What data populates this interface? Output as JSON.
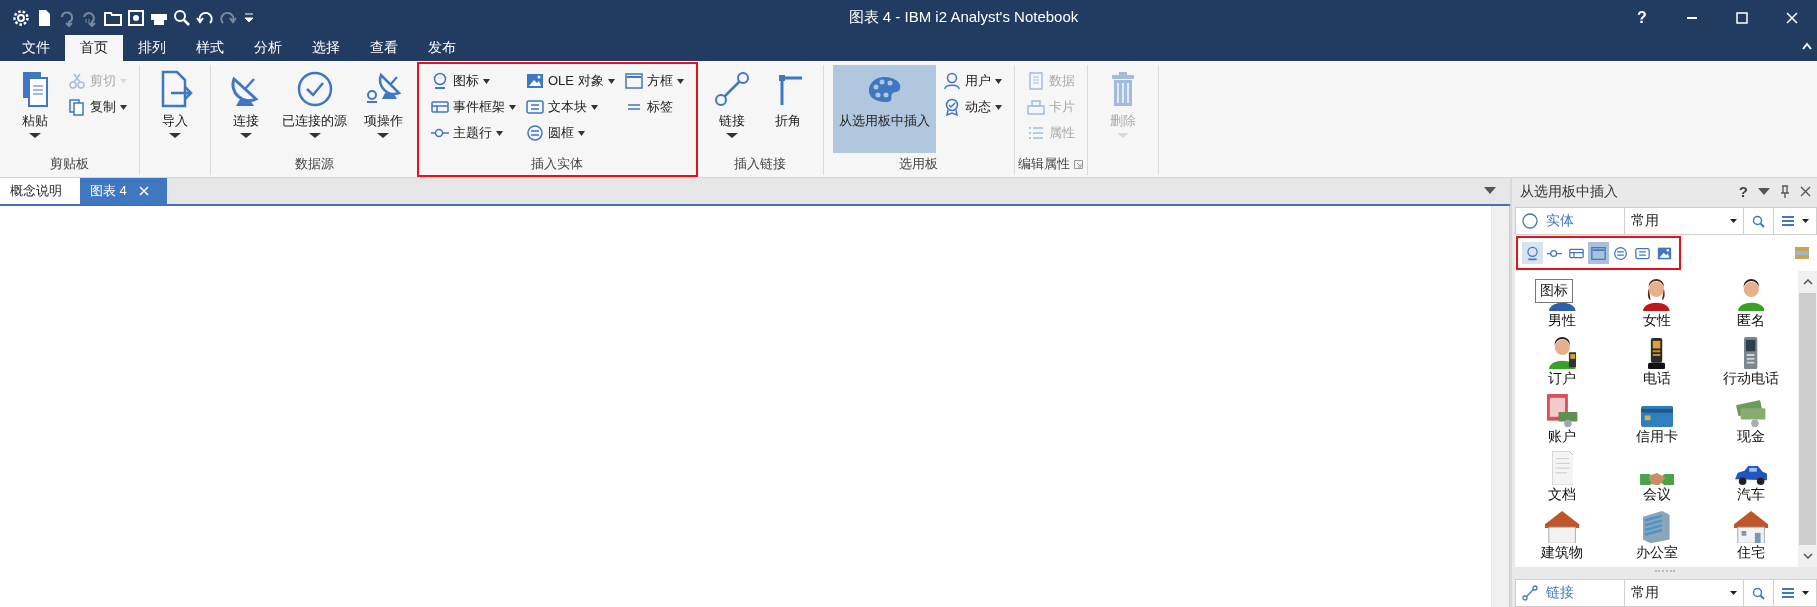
{
  "window": {
    "title": "图表 4 - IBM i2 Analyst's Notebook",
    "help": "?"
  },
  "quick_access_toolbar": [
    {
      "disabled": false
    },
    {
      "disabled": false
    },
    {
      "disabled": true
    },
    {
      "disabled": true
    },
    {
      "disabled": false
    },
    {
      "disabled": false
    },
    {
      "disabled": false
    },
    {
      "disabled": false
    },
    {
      "disabled": false
    },
    {
      "disabled": true
    },
    {
      "disabled": false
    }
  ],
  "menu_tabs": [
    {
      "label": "文件",
      "selected": false
    },
    {
      "label": "首页",
      "selected": true
    },
    {
      "label": "排列",
      "selected": false
    },
    {
      "label": "样式",
      "selected": false
    },
    {
      "label": "分析",
      "selected": false
    },
    {
      "label": "选择",
      "selected": false
    },
    {
      "label": "查看",
      "selected": false
    },
    {
      "label": "发布",
      "selected": false
    }
  ],
  "ribbon": {
    "groups": [
      {
        "label": "剪贴板",
        "columns": [
          {
            "kind": "large",
            "label": "粘贴",
            "dropdown": true
          },
          {
            "kind": "stack",
            "items": [
              {
                "label": "剪切",
                "dropdown": true,
                "disabled": true
              },
              {
                "label": "复制",
                "dropdown": true
              }
            ]
          }
        ]
      },
      {
        "columns": [
          {
            "kind": "large",
            "label": "导入",
            "dropdown": true
          }
        ]
      },
      {
        "label": "数据源",
        "columns": [
          {
            "kind": "large",
            "label": "连接",
            "dropdown": true
          },
          {
            "kind": "large",
            "label": "已连接的源",
            "dropdown": true
          },
          {
            "kind": "large",
            "label": "项操作",
            "dropdown": true
          }
        ]
      },
      {
        "label": "插入实体",
        "highlighted": true,
        "columns": [
          {
            "kind": "stack",
            "items": [
              {
                "label": "图标",
                "dropdown": true
              },
              {
                "label": "事件框架",
                "dropdown": true
              },
              {
                "label": "主题行",
                "dropdown": true
              }
            ]
          },
          {
            "kind": "stack",
            "items": [
              {
                "label": "OLE 对象",
                "dropdown": true
              },
              {
                "label": "文本块",
                "dropdown": true
              },
              {
                "label": "圆框",
                "dropdown": true
              }
            ]
          },
          {
            "kind": "stack",
            "items": [
              {
                "label": "方框",
                "dropdown": true
              },
              {
                "label": "标签"
              }
            ]
          }
        ]
      },
      {
        "label": "插入链接",
        "columns": [
          {
            "kind": "large",
            "label": "链接",
            "dropdown": true
          },
          {
            "kind": "large",
            "label": "折角"
          }
        ]
      },
      {
        "label": "选用板",
        "columns": [
          {
            "kind": "large",
            "label": "从选用板中插入",
            "selected": true
          },
          {
            "kind": "stack",
            "items": [
              {
                "label": "用户",
                "dropdown": true
              },
              {
                "label": "动态",
                "dropdown": true
              }
            ]
          }
        ]
      },
      {
        "label": "编辑属性",
        "launcher": true,
        "columns": [
          {
            "kind": "stack",
            "items": [
              {
                "label": "数据",
                "disabled": true
              },
              {
                "label": "卡片",
                "disabled": true
              },
              {
                "label": "属性",
                "disabled": true
              }
            ]
          }
        ]
      },
      {
        "columns": [
          {
            "kind": "large",
            "label": "删除",
            "dropdown": true,
            "disabled": true
          }
        ]
      }
    ]
  },
  "document_tabs": [
    {
      "label": "概念说明",
      "selected": false,
      "closable": false
    },
    {
      "label": "图表 4",
      "selected": true,
      "closable": true
    }
  ],
  "palette_panel": {
    "title": "从选用板中插入",
    "help": "?",
    "entity_row": {
      "label": "实体",
      "combo": "常用"
    },
    "toolbar": {
      "highlighted": true,
      "buttons": [
        {
          "selected": false,
          "hovered": true
        },
        {
          "selected": false,
          "hovered": false
        },
        {
          "selected": false,
          "hovered": false
        },
        {
          "selected": true,
          "hovered": false
        },
        {
          "selected": false,
          "hovered": false
        },
        {
          "selected": false,
          "hovered": false
        },
        {
          "selected": false,
          "hovered": false
        }
      ]
    },
    "tooltip": "图标",
    "items": [
      {
        "label": "男性"
      },
      {
        "label": "女性"
      },
      {
        "label": "匿名"
      },
      {
        "label": "订户"
      },
      {
        "label": "电话"
      },
      {
        "label": "行动电话"
      },
      {
        "label": "账户"
      },
      {
        "label": "信用卡"
      },
      {
        "label": "现金"
      },
      {
        "label": "文档"
      },
      {
        "label": "会议"
      },
      {
        "label": "汽车"
      },
      {
        "label": "建筑物"
      },
      {
        "label": "办公室"
      },
      {
        "label": "住宅"
      }
    ],
    "link_row": {
      "label": "链接",
      "combo": "常用"
    }
  }
}
